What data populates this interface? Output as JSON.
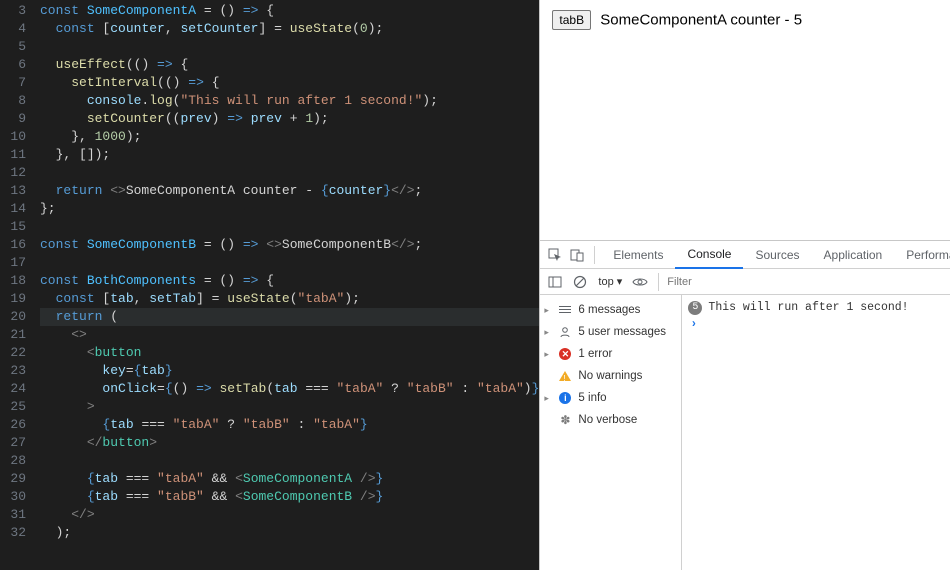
{
  "editor": {
    "first_line_no": 3,
    "lines": [
      {
        "n": 3,
        "tokens": [
          [
            "tok-kw",
            "const "
          ],
          [
            "tok-var",
            "SomeComponentA"
          ],
          [
            "tok-punc",
            " = "
          ],
          [
            "tok-punc",
            "("
          ],
          [
            "tok-punc",
            ")"
          ],
          [
            "tok-arrow",
            " => "
          ],
          [
            "tok-punc",
            "{"
          ]
        ]
      },
      {
        "n": 4,
        "indent": 1,
        "tokens": [
          [
            "tok-kw",
            "const "
          ],
          [
            "tok-punc",
            "["
          ],
          [
            "tok-param",
            "counter"
          ],
          [
            "tok-punc",
            ", "
          ],
          [
            "tok-param",
            "setCounter"
          ],
          [
            "tok-punc",
            "]"
          ],
          [
            "tok-punc",
            " = "
          ],
          [
            "tok-fn",
            "useState"
          ],
          [
            "tok-punc",
            "("
          ],
          [
            "tok-num",
            "0"
          ],
          [
            "tok-punc",
            ");"
          ]
        ]
      },
      {
        "n": 5,
        "tokens": []
      },
      {
        "n": 6,
        "indent": 1,
        "tokens": [
          [
            "tok-fn",
            "useEffect"
          ],
          [
            "tok-punc",
            "(("
          ],
          [
            "tok-punc",
            ")"
          ],
          [
            "tok-arrow",
            " => "
          ],
          [
            "tok-punc",
            "{"
          ]
        ]
      },
      {
        "n": 7,
        "indent": 2,
        "tokens": [
          [
            "tok-fn",
            "setInterval"
          ],
          [
            "tok-punc",
            "(("
          ],
          [
            "tok-punc",
            ")"
          ],
          [
            "tok-arrow",
            " => "
          ],
          [
            "tok-punc",
            "{"
          ]
        ]
      },
      {
        "n": 8,
        "indent": 3,
        "tokens": [
          [
            "tok-param",
            "console"
          ],
          [
            "tok-punc",
            "."
          ],
          [
            "tok-fn",
            "log"
          ],
          [
            "tok-punc",
            "("
          ],
          [
            "tok-str",
            "\"This will run after 1 second!\""
          ],
          [
            "tok-punc",
            ");"
          ]
        ]
      },
      {
        "n": 9,
        "indent": 3,
        "tokens": [
          [
            "tok-fn",
            "setCounter"
          ],
          [
            "tok-punc",
            "(("
          ],
          [
            "tok-param",
            "prev"
          ],
          [
            "tok-punc",
            ")"
          ],
          [
            "tok-arrow",
            " => "
          ],
          [
            "tok-param",
            "prev"
          ],
          [
            "tok-punc",
            " + "
          ],
          [
            "tok-num",
            "1"
          ],
          [
            "tok-punc",
            ");"
          ]
        ]
      },
      {
        "n": 10,
        "indent": 2,
        "tokens": [
          [
            "tok-punc",
            "}, "
          ],
          [
            "tok-num",
            "1000"
          ],
          [
            "tok-punc",
            ");"
          ]
        ]
      },
      {
        "n": 11,
        "indent": 1,
        "tokens": [
          [
            "tok-punc",
            "}, []);"
          ]
        ]
      },
      {
        "n": 12,
        "tokens": []
      },
      {
        "n": 13,
        "indent": 1,
        "tokens": [
          [
            "tok-kw",
            "return "
          ],
          [
            "tok-frag",
            "<>"
          ],
          [
            "tok-text",
            "SomeComponentA counter - "
          ],
          [
            "tok-jsxbrace",
            "{"
          ],
          [
            "tok-param",
            "counter"
          ],
          [
            "tok-jsxbrace",
            "}"
          ],
          [
            "tok-frag",
            "</>"
          ],
          [
            "tok-punc",
            ";"
          ]
        ]
      },
      {
        "n": 14,
        "tokens": [
          [
            "tok-punc",
            "};"
          ]
        ]
      },
      {
        "n": 15,
        "tokens": []
      },
      {
        "n": 16,
        "tokens": [
          [
            "tok-kw",
            "const "
          ],
          [
            "tok-var",
            "SomeComponentB"
          ],
          [
            "tok-punc",
            " = ("
          ],
          [
            "tok-punc",
            ")"
          ],
          [
            "tok-arrow",
            " => "
          ],
          [
            "tok-frag",
            "<>"
          ],
          [
            "tok-text",
            "SomeComponentB"
          ],
          [
            "tok-frag",
            "</>"
          ],
          [
            "tok-punc",
            ";"
          ]
        ]
      },
      {
        "n": 17,
        "tokens": []
      },
      {
        "n": 18,
        "tokens": [
          [
            "tok-kw",
            "const "
          ],
          [
            "tok-var",
            "BothComponents"
          ],
          [
            "tok-punc",
            " = ("
          ],
          [
            "tok-punc",
            ")"
          ],
          [
            "tok-arrow",
            " => "
          ],
          [
            "tok-punc",
            "{"
          ]
        ]
      },
      {
        "n": 19,
        "indent": 1,
        "tokens": [
          [
            "tok-kw",
            "const "
          ],
          [
            "tok-punc",
            "["
          ],
          [
            "tok-param",
            "tab"
          ],
          [
            "tok-punc",
            ", "
          ],
          [
            "tok-param",
            "setTab"
          ],
          [
            "tok-punc",
            "]"
          ],
          [
            "tok-punc",
            " = "
          ],
          [
            "tok-fn",
            "useState"
          ],
          [
            "tok-punc",
            "("
          ],
          [
            "tok-str",
            "\"tabA\""
          ],
          [
            "tok-punc",
            ");"
          ]
        ]
      },
      {
        "n": 20,
        "hl": true,
        "indent": 1,
        "tokens": [
          [
            "tok-kw",
            "return "
          ],
          [
            "tok-punc",
            "("
          ]
        ]
      },
      {
        "n": 21,
        "indent": 2,
        "tokens": [
          [
            "tok-frag",
            "<>"
          ]
        ]
      },
      {
        "n": 22,
        "indent": 3,
        "tokens": [
          [
            "tok-tag",
            "<"
          ],
          [
            "tok-tagname",
            "button"
          ]
        ]
      },
      {
        "n": 23,
        "indent": 4,
        "tokens": [
          [
            "tok-attr",
            "key"
          ],
          [
            "tok-punc",
            "="
          ],
          [
            "tok-jsxbrace",
            "{"
          ],
          [
            "tok-param",
            "tab"
          ],
          [
            "tok-jsxbrace",
            "}"
          ]
        ]
      },
      {
        "n": 24,
        "indent": 4,
        "tokens": [
          [
            "tok-attr",
            "onClick"
          ],
          [
            "tok-punc",
            "="
          ],
          [
            "tok-jsxbrace",
            "{"
          ],
          [
            "tok-punc",
            "("
          ],
          [
            "tok-punc",
            ")"
          ],
          [
            "tok-arrow",
            " => "
          ],
          [
            "tok-fn",
            "setTab"
          ],
          [
            "tok-punc",
            "("
          ],
          [
            "tok-param",
            "tab"
          ],
          [
            "tok-punc",
            " === "
          ],
          [
            "tok-str",
            "\"tabA\""
          ],
          [
            "tok-punc",
            " ? "
          ],
          [
            "tok-str",
            "\"tabB\""
          ],
          [
            "tok-punc",
            " : "
          ],
          [
            "tok-str",
            "\"tabA\""
          ],
          [
            "tok-punc",
            ")"
          ],
          [
            "tok-jsxbrace",
            "}"
          ]
        ]
      },
      {
        "n": 25,
        "indent": 3,
        "tokens": [
          [
            "tok-tag",
            ">"
          ]
        ]
      },
      {
        "n": 26,
        "indent": 4,
        "tokens": [
          [
            "tok-jsxbrace",
            "{"
          ],
          [
            "tok-param",
            "tab"
          ],
          [
            "tok-punc",
            " === "
          ],
          [
            "tok-str",
            "\"tabA\""
          ],
          [
            "tok-punc",
            " ? "
          ],
          [
            "tok-str",
            "\"tabB\""
          ],
          [
            "tok-punc",
            " : "
          ],
          [
            "tok-str",
            "\"tabA\""
          ],
          [
            "tok-jsxbrace",
            "}"
          ]
        ]
      },
      {
        "n": 27,
        "indent": 3,
        "tokens": [
          [
            "tok-tag",
            "</"
          ],
          [
            "tok-tagname",
            "button"
          ],
          [
            "tok-tag",
            ">"
          ]
        ]
      },
      {
        "n": 28,
        "tokens": []
      },
      {
        "n": 29,
        "indent": 3,
        "tokens": [
          [
            "tok-jsxbrace",
            "{"
          ],
          [
            "tok-param",
            "tab"
          ],
          [
            "tok-punc",
            " === "
          ],
          [
            "tok-str",
            "\"tabA\""
          ],
          [
            "tok-punc",
            " && "
          ],
          [
            "tok-tag",
            "<"
          ],
          [
            "tok-tagname",
            "SomeComponentA"
          ],
          [
            "tok-tag",
            " />"
          ],
          [
            "tok-jsxbrace",
            "}"
          ]
        ]
      },
      {
        "n": 30,
        "indent": 3,
        "tokens": [
          [
            "tok-jsxbrace",
            "{"
          ],
          [
            "tok-param",
            "tab"
          ],
          [
            "tok-punc",
            " === "
          ],
          [
            "tok-str",
            "\"tabB\""
          ],
          [
            "tok-punc",
            " && "
          ],
          [
            "tok-tag",
            "<"
          ],
          [
            "tok-tagname",
            "SomeComponentB"
          ],
          [
            "tok-tag",
            " />"
          ],
          [
            "tok-jsxbrace",
            "}"
          ]
        ]
      },
      {
        "n": 31,
        "indent": 2,
        "tokens": [
          [
            "tok-frag",
            "</>"
          ]
        ]
      },
      {
        "n": 32,
        "indent": 1,
        "tokens": [
          [
            "tok-punc",
            ");"
          ]
        ]
      }
    ]
  },
  "preview": {
    "button_label": "tabB",
    "component_text_prefix": "SomeComponentA counter - ",
    "counter_value": "5"
  },
  "devtools": {
    "tabs": [
      "Elements",
      "Console",
      "Sources",
      "Application",
      "Performance"
    ],
    "active_tab_index": 1,
    "context_selector": "top ▾",
    "filter_placeholder": "Filter",
    "sidebar": [
      {
        "arrow": true,
        "icon": "msgs",
        "label": "6 messages"
      },
      {
        "arrow": true,
        "icon": "user",
        "label": "5 user messages"
      },
      {
        "arrow": true,
        "icon": "error",
        "glyph": "✕",
        "label": "1 error"
      },
      {
        "arrow": false,
        "icon": "warn",
        "label": "No warnings"
      },
      {
        "arrow": true,
        "icon": "info",
        "glyph": "i",
        "label": "5 info"
      },
      {
        "arrow": false,
        "icon": "verbose",
        "label": "No verbose"
      }
    ],
    "console": {
      "badge_count": "5",
      "log_text": "This will run after 1 second!",
      "prompt": "›"
    }
  }
}
